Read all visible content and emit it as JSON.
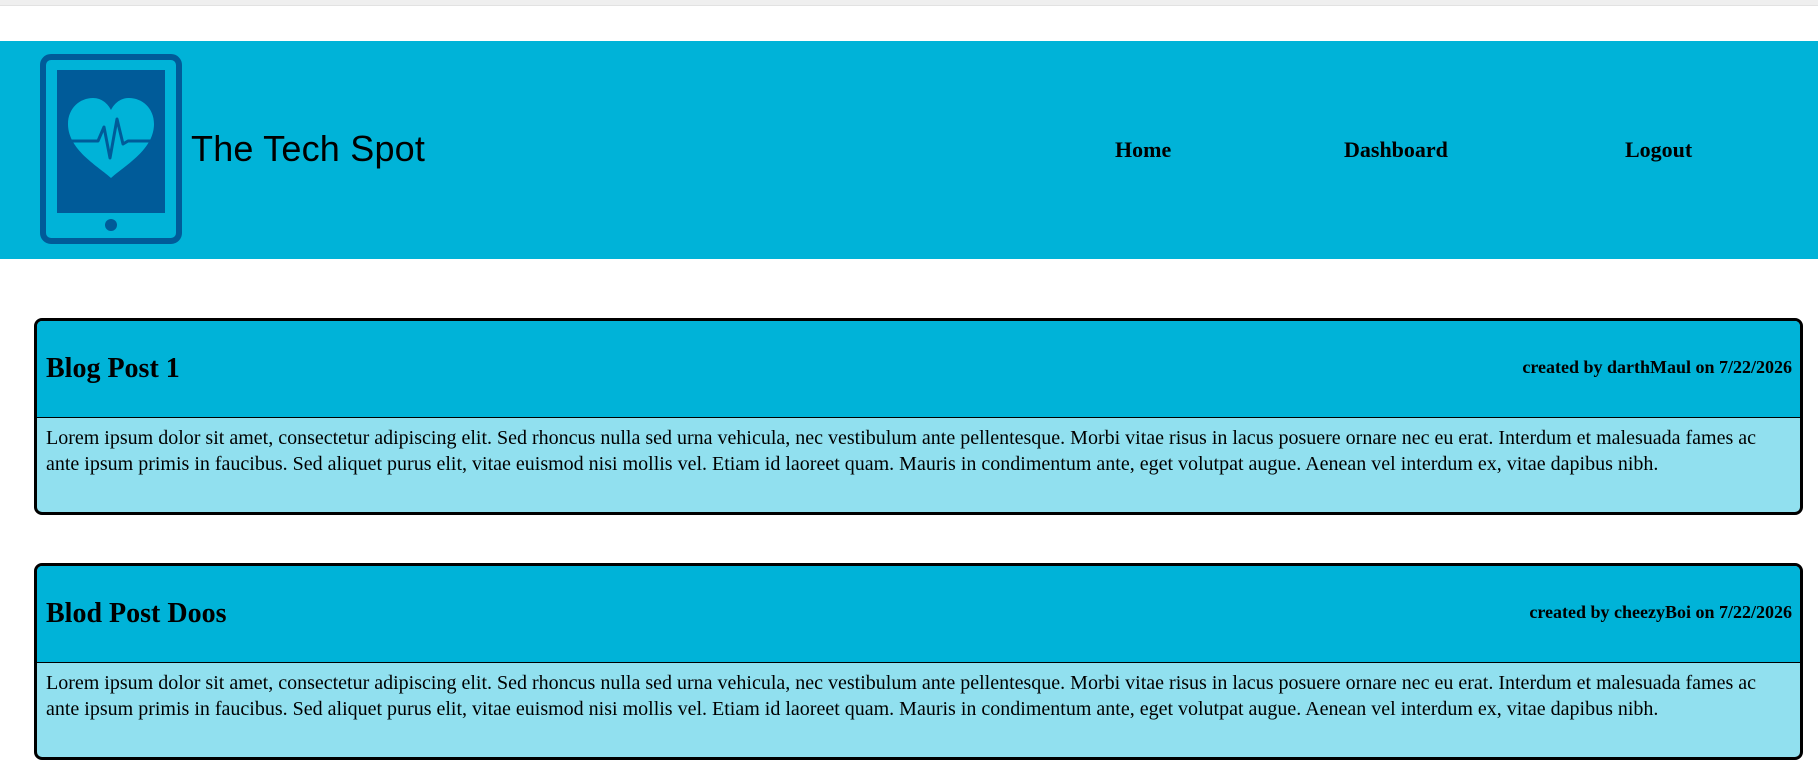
{
  "site": {
    "title": "The Tech Spot",
    "logo_icon": "tablet-heartbeat-icon",
    "colors": {
      "accent": "#00b3d8",
      "post_body_bg": "#91e0ef",
      "logo_dark": "#005b99"
    }
  },
  "nav": {
    "items": [
      {
        "label": "Home"
      },
      {
        "label": "Dashboard"
      },
      {
        "label": "Logout"
      }
    ]
  },
  "posts": [
    {
      "title": "Blog Post 1",
      "meta": "created by darthMaul on 7/22/2026",
      "body": "Lorem ipsum dolor sit amet, consectetur adipiscing elit. Sed rhoncus nulla sed urna vehicula, nec vestibulum ante pellentesque. Morbi vitae risus in lacus posuere ornare nec eu erat. Interdum et malesuada fames ac ante ipsum primis in faucibus. Sed aliquet purus elit, vitae euismod nisi mollis vel. Etiam id laoreet quam. Mauris in condimentum ante, eget volutpat augue. Aenean vel interdum ex, vitae dapibus nibh."
    },
    {
      "title": "Blod Post Doos",
      "meta": "created by cheezyBoi on 7/22/2026",
      "body": "Lorem ipsum dolor sit amet, consectetur adipiscing elit. Sed rhoncus nulla sed urna vehicula, nec vestibulum ante pellentesque. Morbi vitae risus in lacus posuere ornare nec eu erat. Interdum et malesuada fames ac ante ipsum primis in faucibus. Sed aliquet purus elit, vitae euismod nisi mollis vel. Etiam id laoreet quam. Mauris in condimentum ante, eget volutpat augue. Aenean vel interdum ex, vitae dapibus nibh."
    }
  ]
}
